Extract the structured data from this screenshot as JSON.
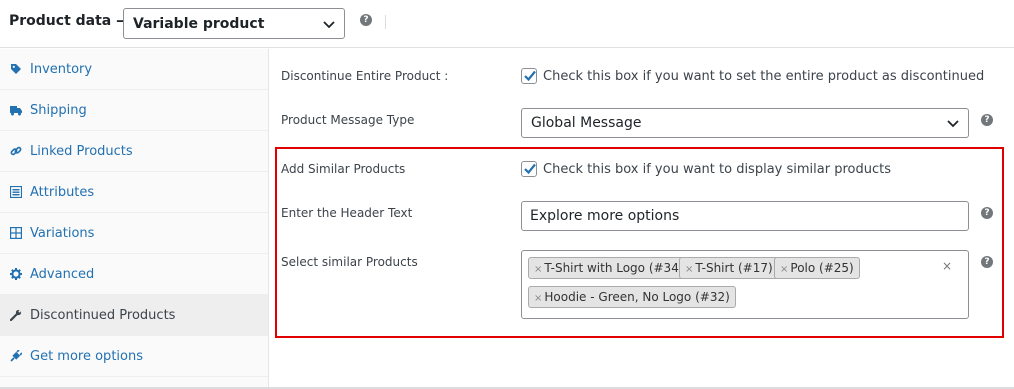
{
  "header": {
    "title": "Product data —",
    "product_type": "Variable product",
    "help_glyph": "?"
  },
  "sidebar": {
    "items": [
      {
        "label": "Inventory",
        "icon": "tag-icon"
      },
      {
        "label": "Shipping",
        "icon": "truck-icon"
      },
      {
        "label": "Linked Products",
        "icon": "link-icon"
      },
      {
        "label": "Attributes",
        "icon": "list-icon"
      },
      {
        "label": "Variations",
        "icon": "grid-icon"
      },
      {
        "label": "Advanced",
        "icon": "gear-icon"
      },
      {
        "label": "Discontinued Products",
        "icon": "wrench-icon",
        "active": true
      },
      {
        "label": "Get more options",
        "icon": "plugin-icon"
      }
    ]
  },
  "form": {
    "discontinue": {
      "label": "Discontinue Entire Product :",
      "checked": true,
      "text": "Check this box if you want to set the entire product as discontinued"
    },
    "message_type": {
      "label": "Product Message Type",
      "value": "Global Message"
    },
    "similar": {
      "label": "Add Similar Products",
      "checked": true,
      "text": "Check this box if you want to display similar products"
    },
    "header_text": {
      "label": "Enter the Header Text",
      "value": "Explore more options"
    },
    "similar_products": {
      "label": "Select similar Products",
      "tags": [
        "T-Shirt with Logo (#34)",
        "T-Shirt (#17)",
        "Polo (#25)",
        "Hoodie - Green, No Logo (#32)"
      ],
      "remove_glyph": "×",
      "clear_glyph": "×"
    }
  },
  "colors": {
    "link": "#2271b1",
    "highlight_border": "#e00000",
    "checkmark": "#2271b1"
  }
}
